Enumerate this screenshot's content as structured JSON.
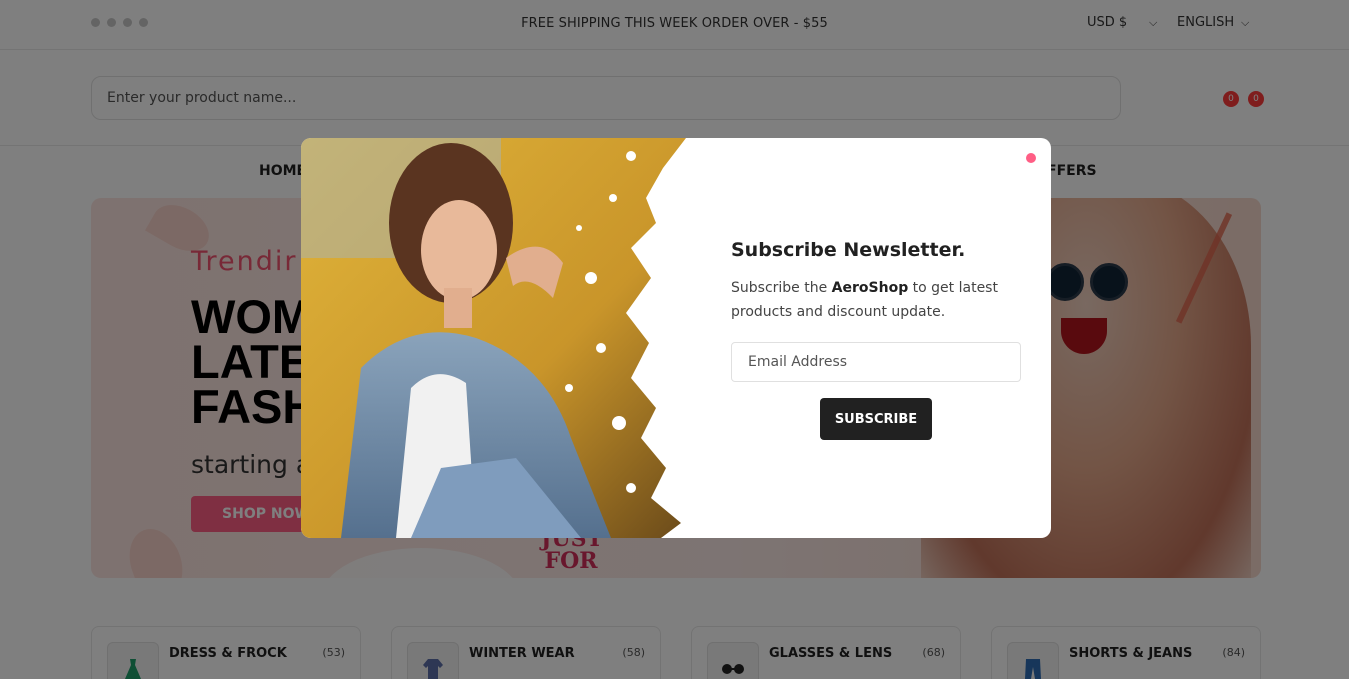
{
  "topbar": {
    "social_icons": [
      "facebook-icon",
      "twitter-icon",
      "instagram-icon",
      "linkedin-icon"
    ],
    "promo": "FREE SHIPPING THIS WEEK ORDER OVER - $55",
    "currency": "USD $",
    "language": "ENGLISH"
  },
  "header": {
    "search_placeholder": "Enter your product name...",
    "wishlist_count": "0",
    "cart_count": "0"
  },
  "nav": {
    "first_item": "HOME",
    "last_item": "FFERS"
  },
  "hero": {
    "subtitle": "Trendir",
    "title_lines": [
      "WOM",
      "LATES",
      "FASH"
    ],
    "price_text": "starting a",
    "button": "SHOP NOW",
    "badge": "JUST FOR you"
  },
  "categories": [
    {
      "name": "DRESS & FROCK",
      "count": "(53)",
      "icon": "dress-icon"
    },
    {
      "name": "WINTER WEAR",
      "count": "(58)",
      "icon": "coat-icon"
    },
    {
      "name": "GLASSES & LENS",
      "count": "(68)",
      "icon": "glasses-icon"
    },
    {
      "name": "SHORTS & JEANS",
      "count": "(84)",
      "icon": "jeans-icon"
    }
  ],
  "modal": {
    "heading": "Subscribe Newsletter.",
    "desc_before": "Subscribe the ",
    "brand": "AeroShop",
    "desc_after": " to get latest products and discount update.",
    "email_placeholder": "Email Address",
    "button": "SUBSCRIBE"
  },
  "colors": {
    "accent": "#ff5e85",
    "badge_red": "#ff3b3b",
    "dark": "#212121",
    "overlay": "rgba(0,0,0,0.5)"
  }
}
